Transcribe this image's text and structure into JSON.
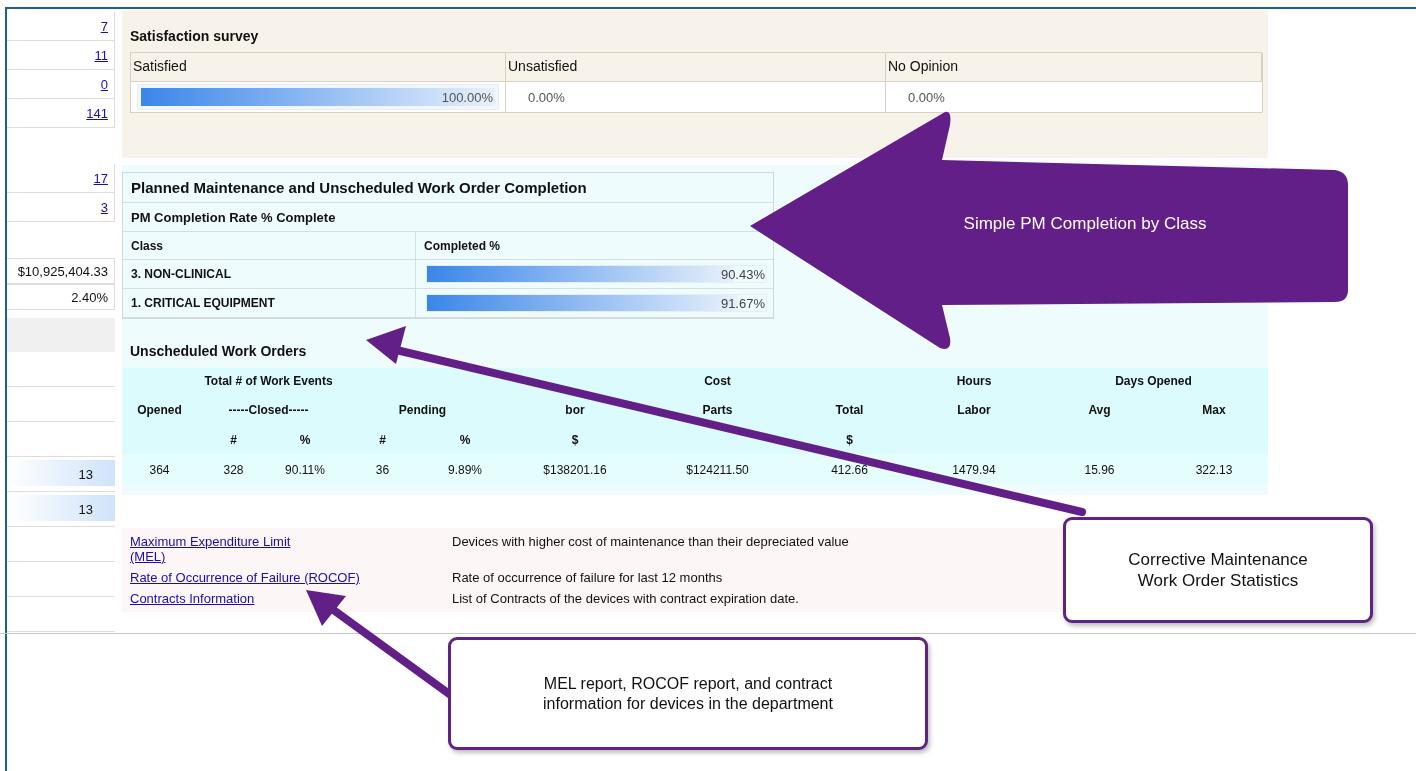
{
  "left_panel": {
    "rows": [
      {
        "kind": "link",
        "value": "7"
      },
      {
        "kind": "link",
        "value": "11"
      },
      {
        "kind": "link",
        "value": "0"
      },
      {
        "kind": "link",
        "value": "141"
      },
      {
        "kind": "spacer"
      },
      {
        "kind": "link",
        "value": "17"
      },
      {
        "kind": "link",
        "value": "3"
      },
      {
        "kind": "spacer"
      },
      {
        "kind": "text",
        "value": "$10,925,404.33"
      },
      {
        "kind": "text",
        "value": "2.40%"
      },
      {
        "kind": "grey"
      },
      {
        "kind": "blank"
      },
      {
        "kind": "blank"
      },
      {
        "kind": "blank"
      },
      {
        "kind": "bar",
        "value": "13",
        "level": 1
      },
      {
        "kind": "bar",
        "value": "13",
        "level": 1
      },
      {
        "kind": "blank"
      },
      {
        "kind": "blank"
      },
      {
        "kind": "blank"
      }
    ]
  },
  "satisfaction_survey": {
    "title": "Satisfaction survey",
    "columns": [
      {
        "label": "Satisfied",
        "value": "100.00%",
        "level": 1
      },
      {
        "label": "Unsatisfied",
        "value": "0.00%"
      },
      {
        "label": "No Opinion",
        "value": "0.00%"
      }
    ]
  },
  "pm_completion": {
    "title": "Planned Maintenance and Unscheduled Work Order Completion",
    "subtitle": "PM Completion Rate % Complete",
    "columns": [
      "Class",
      "Completed %"
    ],
    "rows": [
      {
        "class": "3. NON-CLINICAL",
        "value": "90.43%",
        "level": 0.9043
      },
      {
        "class": "1. CRITICAL EQUIPMENT",
        "value": "91.67%",
        "level": 0.9167
      }
    ]
  },
  "unscheduled": {
    "title": "Unscheduled Work Orders",
    "group_headers": [
      "Total # of Work Events",
      "Cost",
      "Hours",
      "Days Opened"
    ],
    "column_headers": [
      "Opened",
      "-----Closed-----",
      "Pending",
      "bor",
      "Parts",
      "Total",
      "Labor",
      "Avg",
      "Max"
    ],
    "unit_headers": [
      "#",
      "%",
      "#",
      "%",
      "$",
      "$"
    ],
    "values": [
      "364",
      "328",
      "90.11%",
      "36",
      "9.89%",
      "$138201.16",
      "$124211.50",
      "412.66",
      "1479.94",
      "15.96",
      "322.13"
    ]
  },
  "reports": [
    {
      "link": "Maximum Expenditure Limit (MEL)",
      "description": "Devices with higher cost of maintenance than their depreciated value"
    },
    {
      "link": "Rate of Occurrence of Failure (ROCOF)",
      "description": "Rate of occurrence of failure for last 12 months"
    },
    {
      "link": "Contracts Information",
      "description": "List of Contracts of the devices with contract expiration date."
    }
  ],
  "annotations": [
    {
      "kind": "block-arrow",
      "text": "Simple PM Completion by Class"
    },
    {
      "kind": "callout-box",
      "text": "Corrective Maintenance Work Order Statistics"
    },
    {
      "kind": "callout-box",
      "text": "MEL report, ROCOF report, and contract information for devices in the department"
    }
  ]
}
